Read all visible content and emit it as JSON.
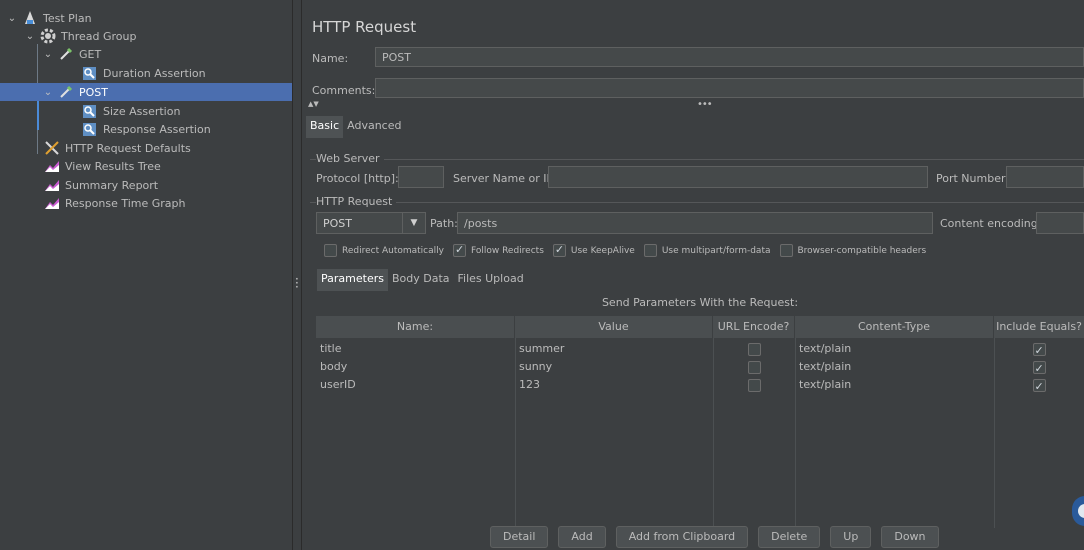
{
  "tree": {
    "items": [
      {
        "label": "Test Plan"
      },
      {
        "label": "Thread Group"
      },
      {
        "label": "GET"
      },
      {
        "label": "Duration Assertion"
      },
      {
        "label": "POST"
      },
      {
        "label": "Size Assertion"
      },
      {
        "label": "Response Assertion"
      },
      {
        "label": "HTTP Request Defaults"
      },
      {
        "label": "View Results Tree"
      },
      {
        "label": "Summary Report"
      },
      {
        "label": "Response Time Graph"
      }
    ]
  },
  "panel": {
    "title": "HTTP Request",
    "name_label": "Name:",
    "name_value": "POST",
    "comments_label": "Comments:",
    "comments_value": "",
    "tabs": [
      {
        "label": "Basic"
      },
      {
        "label": "Advanced"
      }
    ],
    "web_server": {
      "group_label": "Web Server",
      "protocol_label": "Protocol [http]:",
      "protocol_value": "",
      "server_label": "Server Name or IP:",
      "server_value": "",
      "port_label": "Port Number:",
      "port_value": ""
    },
    "http_request": {
      "group_label": "HTTP Request",
      "method": "POST",
      "path_label": "Path:",
      "path_value": "/posts",
      "encoding_label": "Content encoding:",
      "encoding_value": ""
    },
    "options": [
      {
        "label": "Redirect Automatically",
        "checked": false
      },
      {
        "label": "Follow Redirects",
        "checked": true
      },
      {
        "label": "Use KeepAlive",
        "checked": true
      },
      {
        "label": "Use multipart/form-data",
        "checked": false
      },
      {
        "label": "Browser-compatible headers",
        "checked": false
      }
    ],
    "sub_tabs": [
      {
        "label": "Parameters"
      },
      {
        "label": "Body Data"
      },
      {
        "label": "Files Upload"
      }
    ],
    "params": {
      "caption": "Send Parameters With the Request:",
      "columns": [
        "Name:",
        "Value",
        "URL Encode?",
        "Content-Type",
        "Include Equals?"
      ],
      "rows": [
        {
          "name": "title",
          "value": "summer",
          "url_encode": false,
          "content_type": "text/plain",
          "include_equals": true
        },
        {
          "name": "body",
          "value": "sunny",
          "url_encode": false,
          "content_type": "text/plain",
          "include_equals": true
        },
        {
          "name": "userID",
          "value": "123",
          "url_encode": false,
          "content_type": "text/plain",
          "include_equals": true
        }
      ]
    },
    "buttons": [
      {
        "label": "Detail"
      },
      {
        "label": "Add"
      },
      {
        "label": "Add from Clipboard"
      },
      {
        "label": "Delete"
      },
      {
        "label": "Up"
      },
      {
        "label": "Down"
      }
    ]
  },
  "colors": {
    "selection": "#4b6eaf",
    "background": "#3c3f41",
    "field": "#45494a"
  }
}
